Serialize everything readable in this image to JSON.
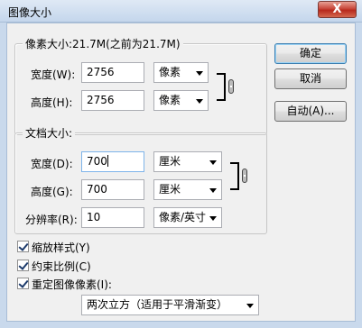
{
  "window": {
    "title": "图像大小",
    "close_label": "X"
  },
  "pixel_dimensions": {
    "title": "像素大小:21.7M(之前为21.7M)",
    "width_label": "宽度(W):",
    "width_value": "2756",
    "width_unit": "像素",
    "height_label": "高度(H):",
    "height_value": "2756",
    "height_unit": "像素"
  },
  "document_size": {
    "title": "文档大小:",
    "width_label": "宽度(D):",
    "width_value": "700",
    "width_unit": "厘米",
    "height_label": "高度(G):",
    "height_value": "700",
    "height_unit": "厘米",
    "resolution_label": "分辨率(R):",
    "resolution_value": "10",
    "resolution_unit": "像素/英寸"
  },
  "buttons": {
    "ok": "确定",
    "cancel": "取消",
    "auto": "自动(A)..."
  },
  "options": {
    "scale_styles": {
      "label": "缩放样式(Y)",
      "checked": true
    },
    "constrain_proportions": {
      "label": "约束比例(C)",
      "checked": true
    },
    "resample": {
      "label": "重定图像像素(I):",
      "checked": true
    }
  },
  "resample_method": "两次立方（适用于平滑渐变）"
}
